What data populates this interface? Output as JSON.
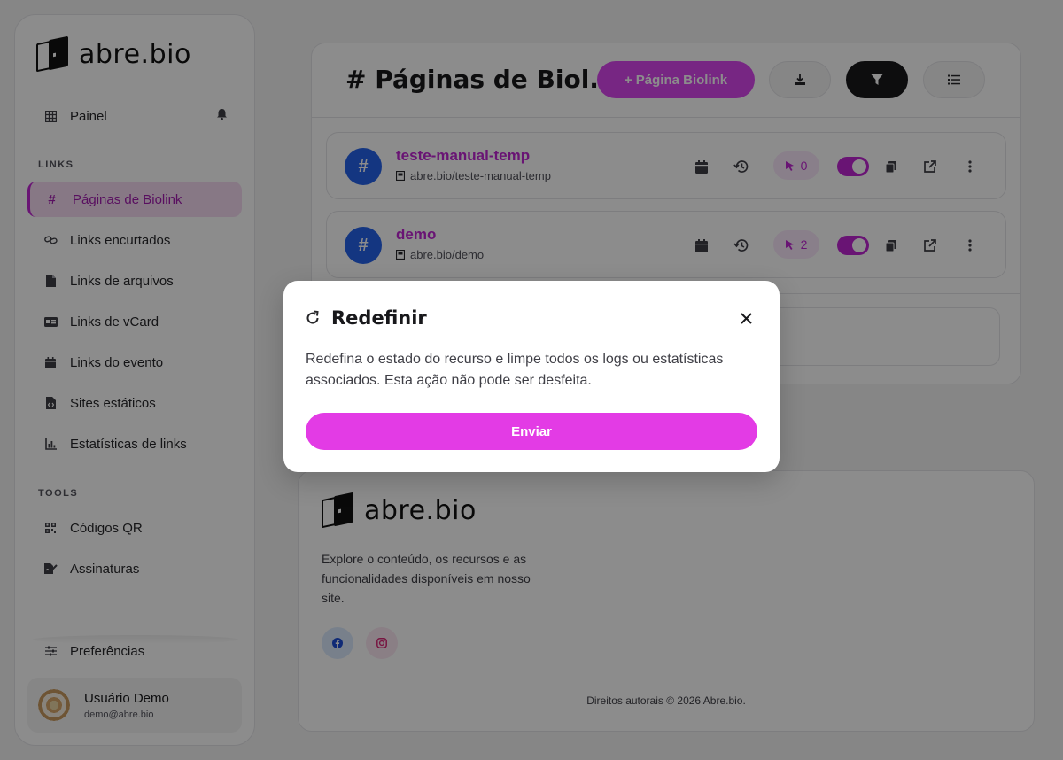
{
  "brand": {
    "name": "abre.bio"
  },
  "sidebar": {
    "dashboard": {
      "label": "Painel"
    },
    "sections": {
      "links": "LINKS",
      "tools": "TOOLS"
    },
    "links_items": [
      {
        "label": "Páginas de Biolink",
        "icon": "hash-icon",
        "active": true
      },
      {
        "label": "Links encurtados",
        "icon": "link-icon"
      },
      {
        "label": "Links de arquivos",
        "icon": "file-icon"
      },
      {
        "label": "Links de vCard",
        "icon": "vcard-icon"
      },
      {
        "label": "Links do evento",
        "icon": "calendar-icon"
      },
      {
        "label": "Sites estáticos",
        "icon": "code-file-icon"
      },
      {
        "label": "Estatísticas de links",
        "icon": "chart-icon"
      }
    ],
    "tools_items": [
      {
        "label": "Códigos QR",
        "icon": "qr-icon"
      },
      {
        "label": "Assinaturas",
        "icon": "signature-icon"
      }
    ],
    "preferences": {
      "label": "Preferências"
    },
    "user": {
      "name": "Usuário Demo",
      "email": "demo@abre.bio"
    }
  },
  "main": {
    "title": "# Páginas de Biol...",
    "add_button": "+ Página Biolink",
    "rows": [
      {
        "name": "teste-manual-temp",
        "url": "abre.bio/teste-manual-temp",
        "clicks": "0",
        "enabled": true
      },
      {
        "name": "demo",
        "url": "abre.bio/demo",
        "clicks": "2",
        "enabled": true
      }
    ],
    "badge_symbol": "#"
  },
  "footer": {
    "description": "Explore o conteúdo, os recursos e as funcionalidades disponíveis em nosso site.",
    "copyright": "Direitos autorais © 2026 Abre.bio."
  },
  "modal": {
    "title": "Redefinir",
    "text": "Redefina o estado do recurso e limpe todos os logs ou estatísticas associados. Esta ação não pode ser desfeita.",
    "submit": "Enviar"
  },
  "colors": {
    "accent": "#d946ef",
    "accent_dark": "#c026d3",
    "badge_blue": "#2563eb"
  }
}
